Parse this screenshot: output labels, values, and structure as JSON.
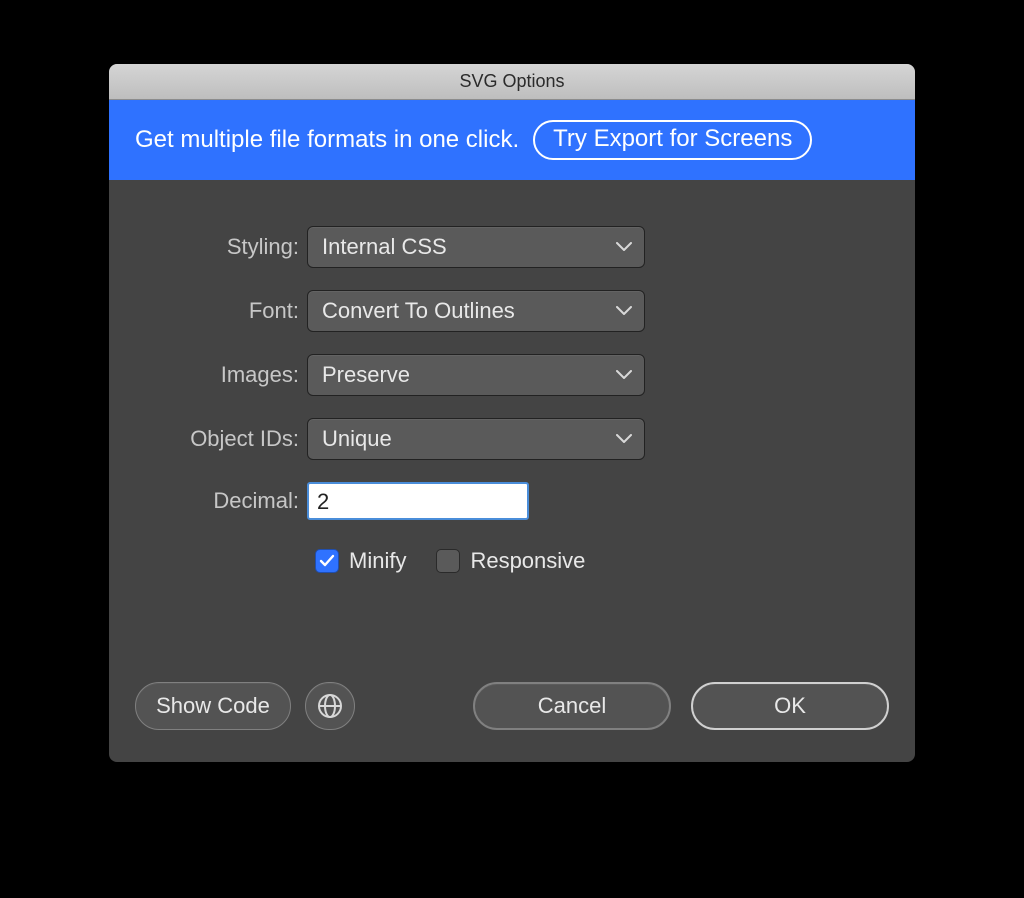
{
  "title": "SVG Options",
  "banner": {
    "text": "Get multiple file formats in one click.",
    "button": "Try Export for Screens"
  },
  "form": {
    "styling_label": "Styling:",
    "styling_value": "Internal CSS",
    "font_label": "Font:",
    "font_value": "Convert To Outlines",
    "images_label": "Images:",
    "images_value": "Preserve",
    "objectids_label": "Object IDs:",
    "objectids_value": "Unique",
    "decimal_label": "Decimal:",
    "decimal_value": "2",
    "minify_label": "Minify",
    "minify_checked": true,
    "responsive_label": "Responsive",
    "responsive_checked": false
  },
  "footer": {
    "show_code": "Show Code",
    "cancel": "Cancel",
    "ok": "OK"
  }
}
